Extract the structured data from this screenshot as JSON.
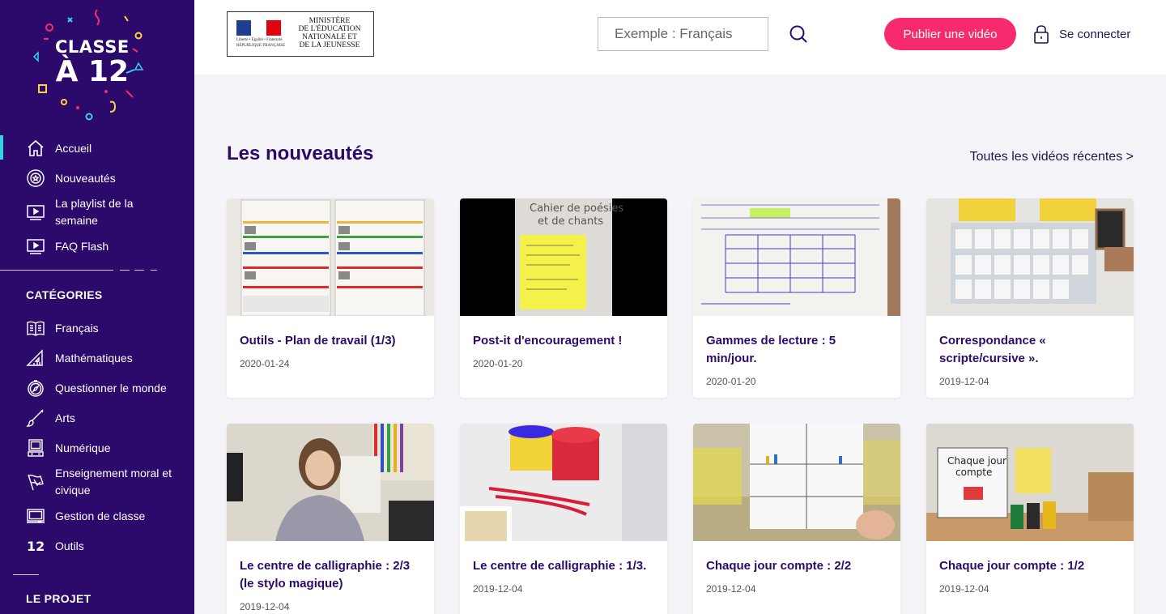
{
  "sidebar": {
    "logo": {
      "line1": "CLASSE",
      "line2": "À 12"
    },
    "nav": [
      {
        "label": "Accueil",
        "icon": "home-icon"
      },
      {
        "label": "Nouveautés",
        "icon": "badge-icon"
      },
      {
        "label": "La playlist de la semaine",
        "icon": "playlist-icon"
      },
      {
        "label": "FAQ Flash",
        "icon": "video-icon"
      }
    ],
    "categories_title": "CATÉGORIES",
    "categories": [
      {
        "label": "Français",
        "icon": "book-icon"
      },
      {
        "label": "Mathématiques",
        "icon": "ruler-triangle-icon"
      },
      {
        "label": "Questionner le monde",
        "icon": "compass-icon"
      },
      {
        "label": "Arts",
        "icon": "brush-icon"
      },
      {
        "label": "Numérique",
        "icon": "computer-icon"
      },
      {
        "label": "Enseignement moral et civique",
        "icon": "flag-icon"
      },
      {
        "label": "Gestion de classe",
        "icon": "board-icon"
      },
      {
        "label": "Outils",
        "icon": "twelve-icon"
      }
    ],
    "project_title": "LE PROJET"
  },
  "header": {
    "ministry": {
      "line1": "MINISTÈRE",
      "line2": "DE L'ÉDUCATION",
      "line3": "NATIONALE ET",
      "line4": "DE LA JEUNESSE",
      "motto": "Liberté • Égalité • Fraternité",
      "republic": "RÉPUBLIQUE FRANÇAISE"
    },
    "search_placeholder": "Exemple : Français",
    "publish_label": "Publier une vidéo",
    "login_label": "Se connecter"
  },
  "main": {
    "title": "Les nouveautés",
    "all_link": "Toutes les vidéos récentes >",
    "cards": [
      {
        "title": "Outils - Plan de travail (1/3)",
        "date": "2020-01-24"
      },
      {
        "title": "Post-it d'encouragement !",
        "date": "2020-01-20"
      },
      {
        "title": "Gammes de lecture : 5 min/jour.",
        "date": "2020-01-20"
      },
      {
        "title": "Correspondance « scripte/cursive ».",
        "date": "2019-12-04"
      },
      {
        "title": "Le centre de calligraphie : 2/3 (le stylo magique)",
        "date": "2019-12-04"
      },
      {
        "title": "Le centre de calligraphie : 1/3.",
        "date": "2019-12-04"
      },
      {
        "title": "Chaque jour compte : 2/2",
        "date": "2019-12-04"
      },
      {
        "title": "Chaque jour compte : 1/2",
        "date": "2019-12-04"
      }
    ]
  },
  "colors": {
    "sidebar": "#2c0a6b",
    "accent_pink": "#f72a6e",
    "active_bar": "#34d3e6",
    "title": "#2c0a6b"
  }
}
